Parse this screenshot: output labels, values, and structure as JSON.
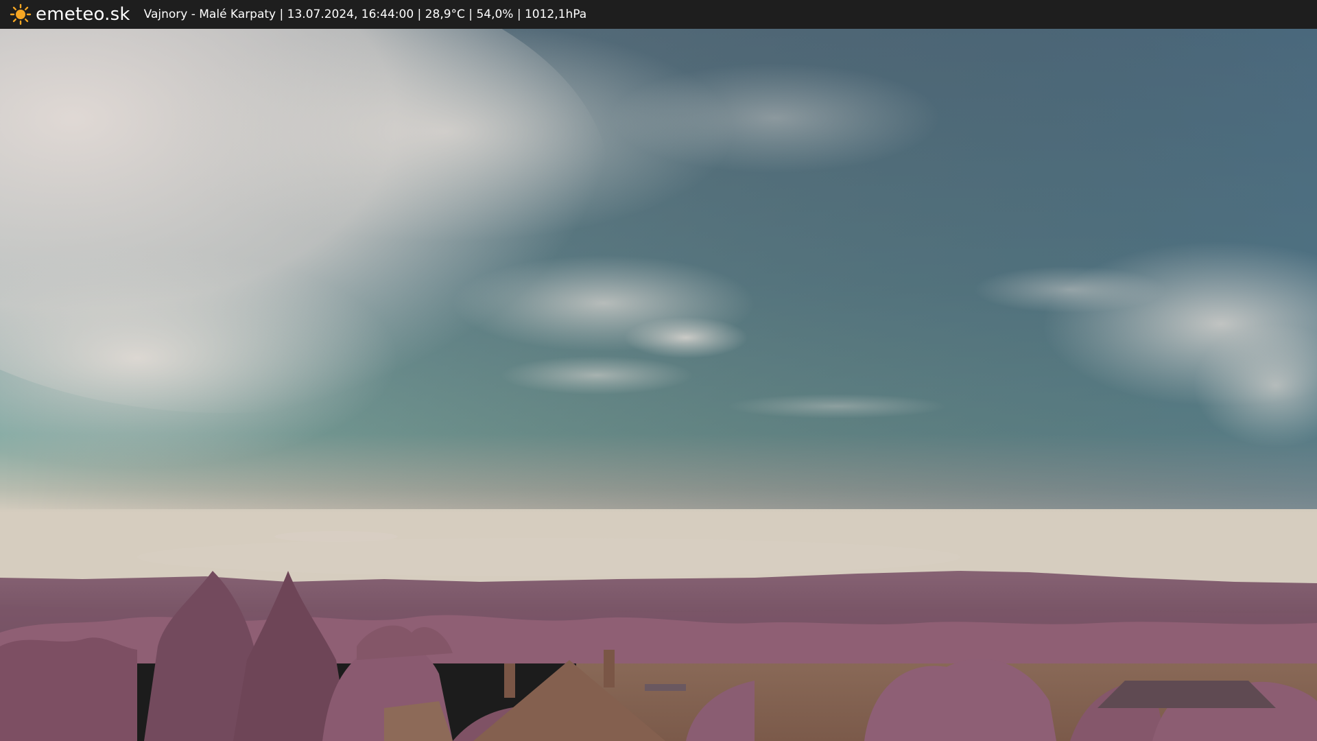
{
  "header": {
    "logo_text": "emeteo.sk",
    "caption": "Vajnory - Malé Karpaty | 13.07.2024, 16:44:00 | 28,9°C | 54,0% | 1012,1hPa",
    "logo_icon": "sun-icon"
  },
  "colors": {
    "header_bg": "#1e1e1e",
    "sun": "#f5a623",
    "sky_top": "#5e7d8f",
    "sky_horizon": "#7fa8a3",
    "hills": "#7a5568",
    "trees": "#8e5e74"
  }
}
